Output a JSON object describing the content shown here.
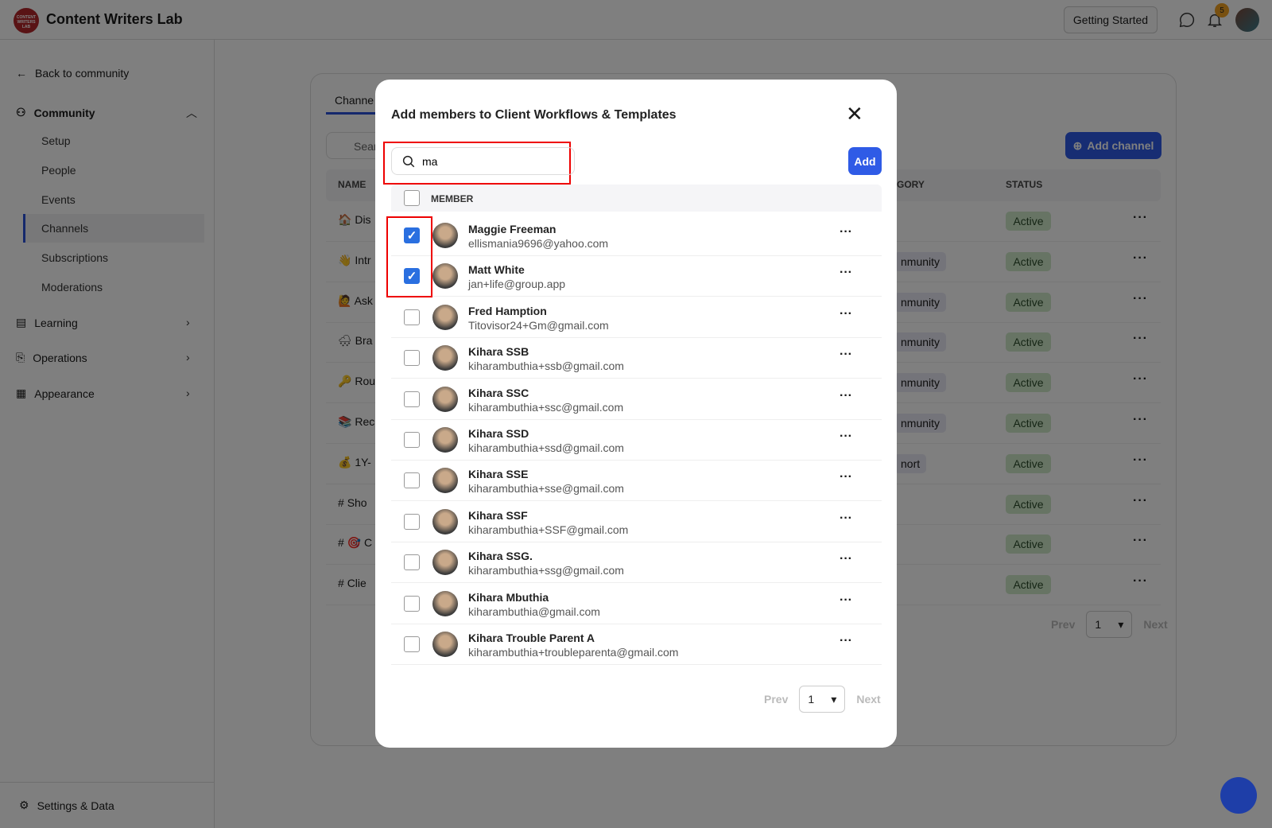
{
  "header": {
    "app_title": "Content Writers Lab",
    "logo_text": "CONTENT WRITERS LAB",
    "getting_started": "Getting Started",
    "notifications_count": "5"
  },
  "sidebar": {
    "back": "Back to community",
    "community": "Community",
    "community_items": [
      "Setup",
      "People",
      "Events",
      "Channels",
      "Subscriptions",
      "Moderations"
    ],
    "active_item": "Channels",
    "sections": [
      "Learning",
      "Operations",
      "Appearance"
    ],
    "settings": "Settings & Data"
  },
  "main": {
    "tab": "Channels",
    "tab_visible": "Channe",
    "search_placeholder_visible": "Sear",
    "add_channel": "Add channel",
    "columns": {
      "name": "NAME",
      "category_visible": "GORY",
      "status": "STATUS"
    },
    "rows": [
      {
        "icon": "🏠",
        "name_visible": "Dis",
        "category_visible": "",
        "status": "Active"
      },
      {
        "icon": "👋",
        "name_visible": "Intr",
        "category_visible": "nmunity",
        "status": "Active"
      },
      {
        "icon": "🙋",
        "name_visible": "Ask",
        "category_visible": "nmunity",
        "status": "Active"
      },
      {
        "icon": "🌨",
        "name_visible": "Bra",
        "category_visible": "nmunity",
        "status": "Active"
      },
      {
        "icon": "🔑",
        "name_visible": "Rou",
        "category_visible": "nmunity",
        "status": "Active"
      },
      {
        "icon": "📚",
        "name_visible": "Rec",
        "category_visible": "nmunity",
        "status": "Active"
      },
      {
        "icon": "💰",
        "name_visible": "1Y-",
        "category_visible": "nort",
        "status": "Active"
      },
      {
        "icon": "#",
        "name_visible": "Sho",
        "category_visible": "",
        "status": "Active"
      },
      {
        "icon": "# 🎯",
        "name_visible": "C",
        "category_visible": "",
        "status": "Active"
      },
      {
        "icon": "#",
        "name_visible": "Clie",
        "category_visible": "",
        "status": "Active"
      }
    ],
    "pager": {
      "prev": "Prev",
      "page": "1",
      "next": "Next"
    }
  },
  "modal": {
    "title": "Add members to Client Workflows & Templates",
    "search_value": "ma",
    "add": "Add",
    "column": "MEMBER",
    "members": [
      {
        "name": "Maggie Freeman",
        "email": "ellismania9696@yahoo.com",
        "checked": true
      },
      {
        "name": "Matt White",
        "email": "jan+life@group.app",
        "checked": true
      },
      {
        "name": "Fred Hamption",
        "email": "Titovisor24+Gm@gmail.com",
        "checked": false
      },
      {
        "name": "Kihara SSB",
        "email": "kiharambuthia+ssb@gmail.com",
        "checked": false
      },
      {
        "name": "Kihara SSC",
        "email": "kiharambuthia+ssc@gmail.com",
        "checked": false
      },
      {
        "name": "Kihara SSD",
        "email": "kiharambuthia+ssd@gmail.com",
        "checked": false
      },
      {
        "name": "Kihara SSE",
        "email": "kiharambuthia+sse@gmail.com",
        "checked": false
      },
      {
        "name": "Kihara SSF",
        "email": "kiharambuthia+SSF@gmail.com",
        "checked": false
      },
      {
        "name": "Kihara SSG.",
        "email": "kiharambuthia+ssg@gmail.com",
        "checked": false
      },
      {
        "name": "Kihara Mbuthia",
        "email": "kiharambuthia@gmail.com",
        "checked": false
      },
      {
        "name": "Kihara Trouble Parent A",
        "email": "kiharambuthia+troubleparenta@gmail.com",
        "checked": false
      }
    ],
    "pager": {
      "prev": "Prev",
      "page": "1",
      "next": "Next"
    }
  },
  "colors": {
    "accent": "#2f5be6",
    "highlight": "#e00000",
    "active_badge": "#cfe8c8"
  }
}
